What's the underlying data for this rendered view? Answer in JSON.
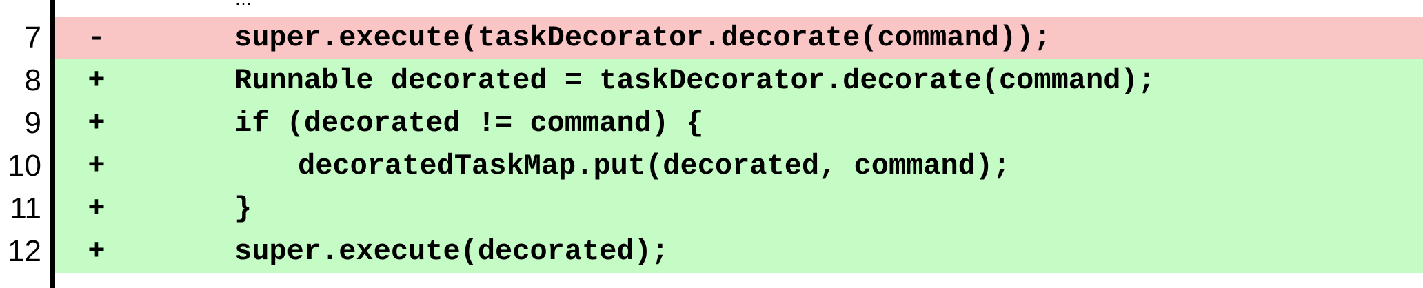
{
  "colors": {
    "removed_bg": "#f9c5c5",
    "added_bg": "#c5fbc5",
    "gutter": "#000000"
  },
  "ellipsis": "…",
  "lines": [
    {
      "num": "7",
      "marker": "-",
      "type": "removed",
      "code": "super.execute(taskDecorator.decorate(command));"
    },
    {
      "num": "8",
      "marker": "+",
      "type": "added",
      "code": "Runnable decorated = taskDecorator.decorate(command);"
    },
    {
      "num": "9",
      "marker": "+",
      "type": "added",
      "code": "if (decorated != command) {"
    },
    {
      "num": "10",
      "marker": "+",
      "type": "added",
      "code": "decoratedTaskMap.put(decorated, command);"
    },
    {
      "num": "11",
      "marker": "+",
      "type": "added",
      "code": "}"
    },
    {
      "num": "12",
      "marker": "+",
      "type": "added",
      "code": "super.execute(decorated);"
    }
  ]
}
